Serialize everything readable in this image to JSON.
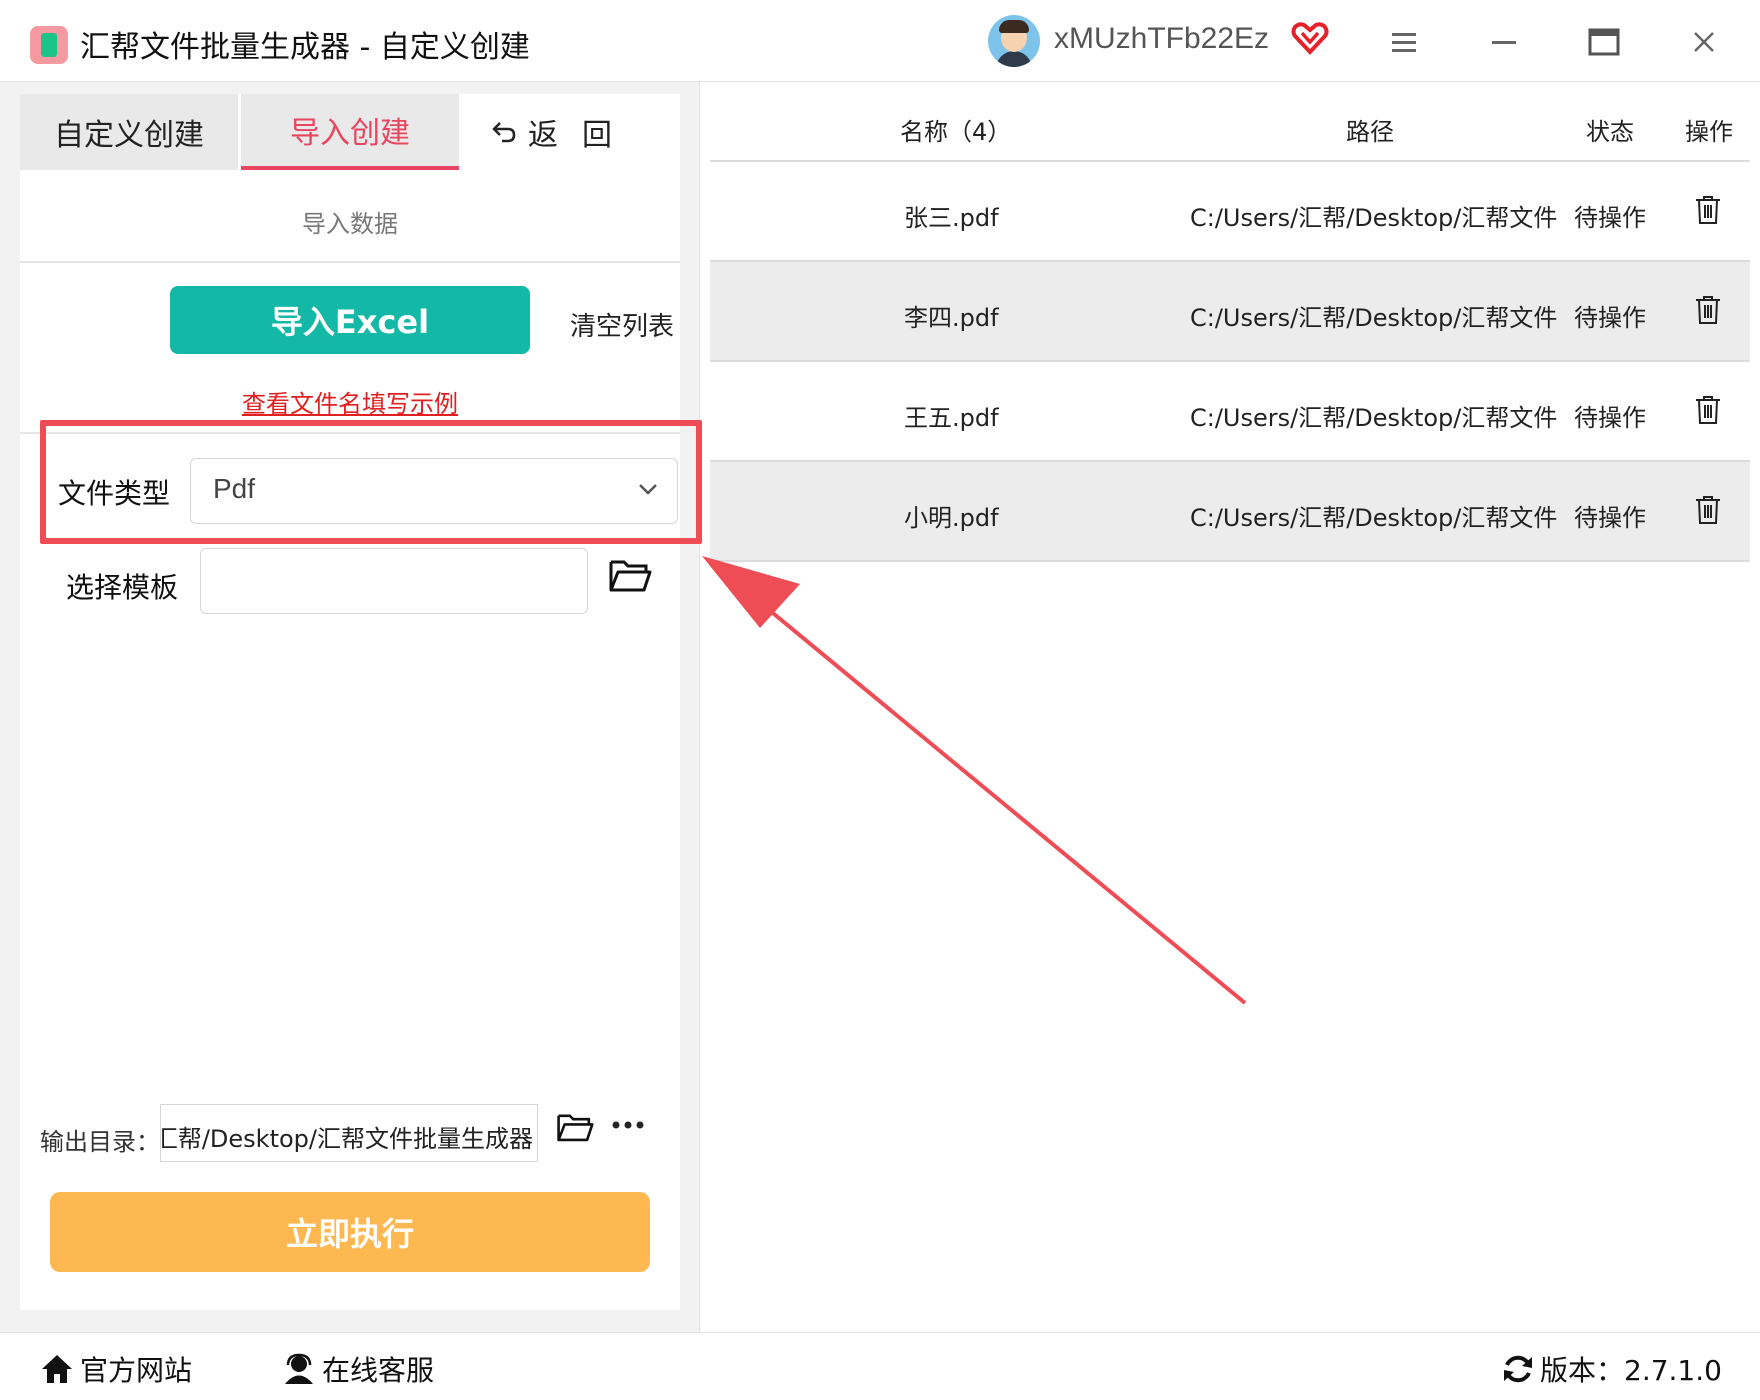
{
  "window": {
    "title": "汇帮文件批量生成器 - 自定义创建",
    "username": "xMUzhTFb22Ez"
  },
  "tabs": {
    "custom_create": "自定义创建",
    "import_create": "导入创建",
    "back": "返回"
  },
  "import_panel": {
    "section_title": "导入数据",
    "import_excel_label": "导入Excel",
    "clear_list_label": "清空列表",
    "example_link": "查看文件名填写示例",
    "file_type_label": "文件类型",
    "file_type_value": "Pdf",
    "template_label": "选择模板",
    "template_value": "",
    "output_label": "输出目录：",
    "output_path": "C:/Users/汇帮/Desktop/汇帮文件批量生成器",
    "run_label": "立即执行"
  },
  "table": {
    "headers": {
      "name": "名称（4）",
      "path": "路径",
      "status": "状态",
      "action": "操作"
    },
    "rows": [
      {
        "name": "张三.pdf",
        "path": "C:/Users/汇帮/Desktop/汇帮文件",
        "status": "待操作"
      },
      {
        "name": "李四.pdf",
        "path": "C:/Users/汇帮/Desktop/汇帮文件",
        "status": "待操作"
      },
      {
        "name": "王五.pdf",
        "path": "C:/Users/汇帮/Desktop/汇帮文件",
        "status": "待操作"
      },
      {
        "name": "小明.pdf",
        "path": "C:/Users/汇帮/Desktop/汇帮文件",
        "status": "待操作"
      }
    ]
  },
  "footer": {
    "website": "官方网站",
    "support": "在线客服",
    "version": "版本：2.7.1.0"
  },
  "colors": {
    "accent_pink": "#e94560",
    "teal_button": "#14b8a6",
    "orange_button": "#fdb851",
    "annotation_red": "#ef4d55"
  },
  "icons": [
    "app-logo",
    "user-avatar",
    "vip-heart-icon",
    "menu-icon",
    "minimize-icon",
    "maximize-icon",
    "close-icon",
    "back-arrow-icon",
    "chevron-down-icon",
    "folder-icon",
    "more-icon",
    "trash-icon",
    "home-icon",
    "support-icon",
    "refresh-icon"
  ]
}
